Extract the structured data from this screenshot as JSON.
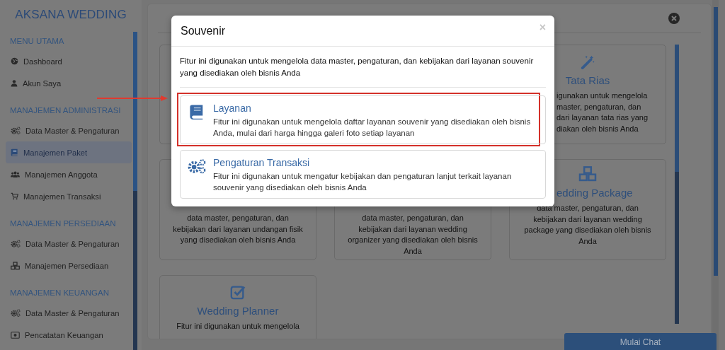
{
  "sidebar": {
    "brand": "AKSANA WEDDING",
    "sections": [
      {
        "heading": "MENU UTAMA",
        "items": [
          {
            "label": "Dashboard",
            "selected": false
          },
          {
            "label": "Akun Saya",
            "selected": false
          }
        ]
      },
      {
        "heading": "MANAJEMEN ADMINISTRASI",
        "items": [
          {
            "label": "Data Master & Pengaturan",
            "selected": false
          },
          {
            "label": "Manajemen Paket",
            "selected": true
          },
          {
            "label": "Manajemen Anggota",
            "selected": false
          },
          {
            "label": "Manajemen Transaksi",
            "selected": false
          }
        ]
      },
      {
        "heading": "MANAJEMEN PERSEDIAAN",
        "items": [
          {
            "label": "Data Master & Pengaturan",
            "selected": false
          },
          {
            "label": "Manajemen Persediaan",
            "selected": false
          }
        ]
      },
      {
        "heading": "MANAJEMEN KEUANGAN",
        "items": [
          {
            "label": "Data Master & Pengaturan",
            "selected": false
          },
          {
            "label": "Pencatatan Keuangan",
            "selected": false
          }
        ]
      }
    ]
  },
  "main": {
    "cards": [
      {
        "title": "Tata Rias",
        "lines": [
          "igunakan untuk mengelola",
          "master, pengaturan, dan",
          "dari layanan tata rias yang",
          "diakan oleh bisnis Anda"
        ]
      },
      {
        "lines": [
          "data master, pengaturan, dan",
          "kebijakan dari layanan undangan fisik",
          "yang disediakan oleh bisnis Anda"
        ]
      },
      {
        "lines": [
          "data master, pengaturan, dan",
          "kebijakan dari layanan wedding",
          "organizer yang disediakan oleh bisnis",
          "Anda"
        ]
      },
      {
        "title": "edding Package",
        "lines": [
          "data master, pengaturan, dan",
          "kebijakan dari layanan wedding",
          "package yang disediakan oleh bisnis",
          "Anda"
        ]
      },
      {
        "title": "Wedding Planner",
        "lines": [
          "Fitur ini digunakan untuk mengelola"
        ]
      }
    ]
  },
  "modal": {
    "title": "Souvenir",
    "close": "×",
    "description": "Fitur ini digunakan untuk mengelola data master, pengaturan, dan kebijakan dari layanan souvenir yang disediakan oleh bisnis Anda",
    "options": [
      {
        "title": "Layanan",
        "description": "Fitur ini digunakan untuk mengelola daftar layanan souvenir yang disediakan oleh bisnis Anda, mulai dari harga hingga galeri foto setiap layanan",
        "highlighted": true
      },
      {
        "title": "Pengaturan Transaksi",
        "description": "Fitur ini digunakan untuk mengatur kebijakan dan pengaturan lanjut terkait layanan souvenir yang disediakan oleh bisnis Anda",
        "highlighted": false
      }
    ]
  },
  "chat_button": "Mulai Chat"
}
